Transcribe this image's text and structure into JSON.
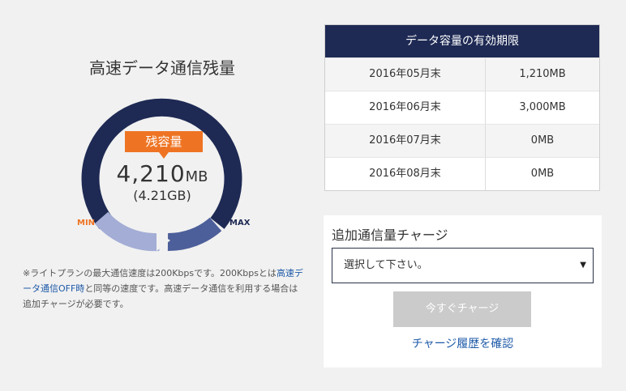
{
  "gauge": {
    "title": "高速データ通信残量",
    "badge": "残容量",
    "remaining_value": "4,210",
    "remaining_unit": "MB",
    "remaining_gb": "(4.21GB)",
    "min_label": "MIN",
    "max_label": "MAX",
    "colors": {
      "track": "#1e2a54",
      "fill_dark": "#4d5f9a",
      "fill_light": "#a3add5",
      "accent": "#ee7423"
    }
  },
  "note": {
    "part1": "※ライトプランの最大通信速度は200Kbpsです。200Kbpsとは",
    "link": "高速データ通信OFF時",
    "part2": "と同等の速度です。高速データ通信を利用する場合は追加チャージが必要です。"
  },
  "expiry_table": {
    "header": "データ容量の有効期限",
    "rows": [
      {
        "period": "2016年05月末",
        "amount": "1,210MB"
      },
      {
        "period": "2016年06月末",
        "amount": "3,000MB"
      },
      {
        "period": "2016年07月末",
        "amount": "0MB"
      },
      {
        "period": "2016年08月末",
        "amount": "0MB"
      }
    ]
  },
  "charge": {
    "title": "追加通信量チャージ",
    "select_value": "選択して下さい。",
    "button_label": "今すぐチャージ",
    "history_link": "チャージ履歴を確認"
  }
}
